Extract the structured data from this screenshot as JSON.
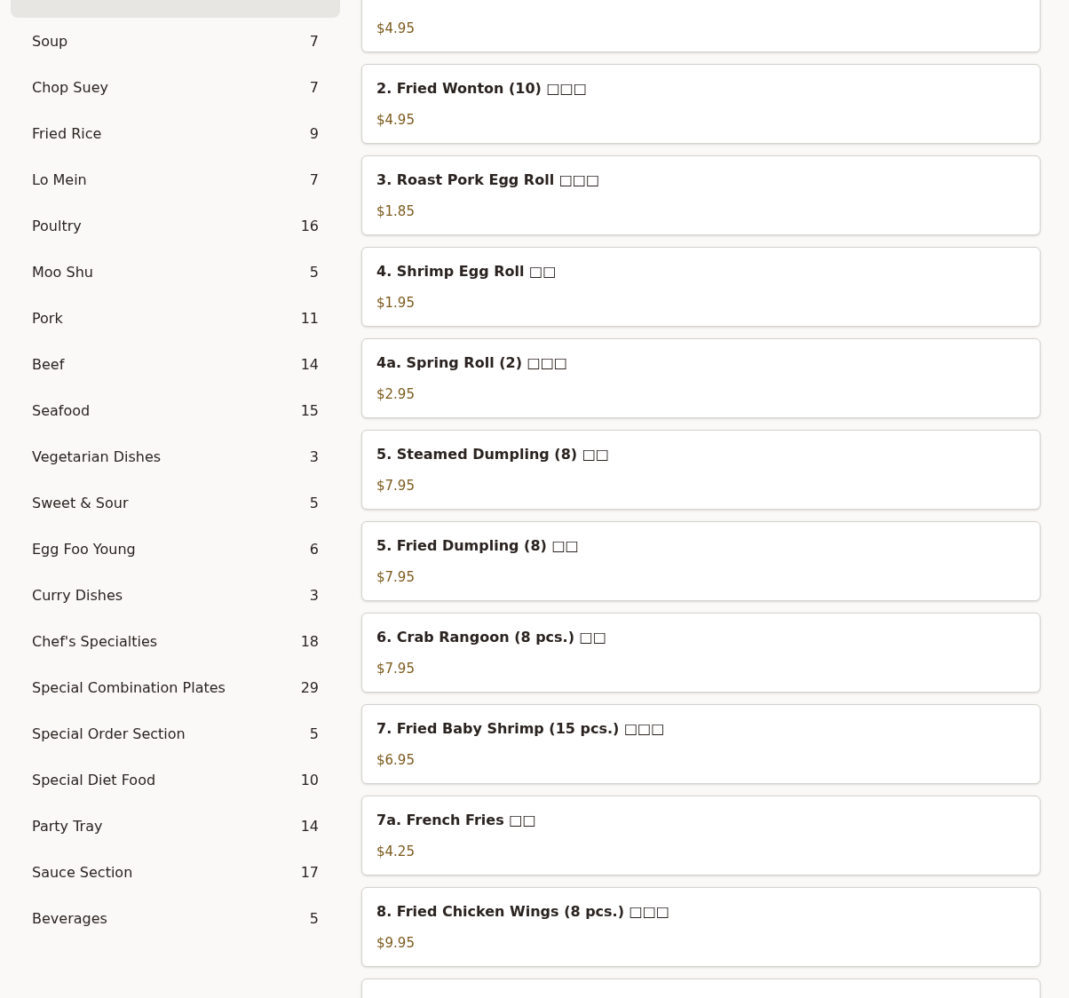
{
  "categories": [
    {
      "selected": true
    },
    {
      "name": "Soup",
      "count": "7",
      "selected": false
    },
    {
      "name": "Chop Suey",
      "count": "7",
      "selected": false
    },
    {
      "name": "Fried Rice",
      "count": "9",
      "selected": false
    },
    {
      "name": "Lo Mein",
      "count": "7",
      "selected": false
    },
    {
      "name": "Poultry",
      "count": "16",
      "selected": false
    },
    {
      "name": "Moo Shu",
      "count": "5",
      "selected": false
    },
    {
      "name": "Pork",
      "count": "11",
      "selected": false
    },
    {
      "name": "Beef",
      "count": "14",
      "selected": false
    },
    {
      "name": "Seafood",
      "count": "15",
      "selected": false
    },
    {
      "name": "Vegetarian Dishes",
      "count": "3",
      "selected": false
    },
    {
      "name": "Sweet & Sour",
      "count": "5",
      "selected": false
    },
    {
      "name": "Egg Foo Young",
      "count": "6",
      "selected": false
    },
    {
      "name": "Curry Dishes",
      "count": "3",
      "selected": false
    },
    {
      "name": "Chef's Specialties",
      "count": "18",
      "selected": false
    },
    {
      "name": "Special Combination Plates",
      "count": "29",
      "selected": false
    },
    {
      "name": "Special Order Section",
      "count": "5",
      "selected": false
    },
    {
      "name": "Special Diet Food",
      "count": "10",
      "selected": false
    },
    {
      "name": "Party Tray",
      "count": "14",
      "selected": false
    },
    {
      "name": "Sauce Section",
      "count": "17",
      "selected": false
    },
    {
      "name": "Beverages",
      "count": "5",
      "selected": false
    }
  ],
  "items": [
    {
      "price": "$4.95"
    },
    {
      "name": "2. Fried Wonton (10) □□□",
      "price": "$4.95"
    },
    {
      "name": "3. Roast Pork Egg Roll □□□",
      "price": "$1.85"
    },
    {
      "name": "4. Shrimp Egg Roll □□",
      "price": "$1.95"
    },
    {
      "name": "4a. Spring Roll (2) □□□",
      "price": "$2.95"
    },
    {
      "name": "5. Steamed Dumpling (8) □□",
      "price": "$7.95"
    },
    {
      "name": "5. Fried Dumpling (8) □□",
      "price": "$7.95"
    },
    {
      "name": "6. Crab Rangoon (8 pcs.) □□",
      "price": "$7.95"
    },
    {
      "name": "7. Fried Baby Shrimp (15 pcs.) □□□",
      "price": "$6.95"
    },
    {
      "name": "7a. French Fries □□",
      "price": "$4.25"
    },
    {
      "name": "8. Fried Chicken Wings (8 pcs.) □□□",
      "price": "$9.95"
    }
  ]
}
